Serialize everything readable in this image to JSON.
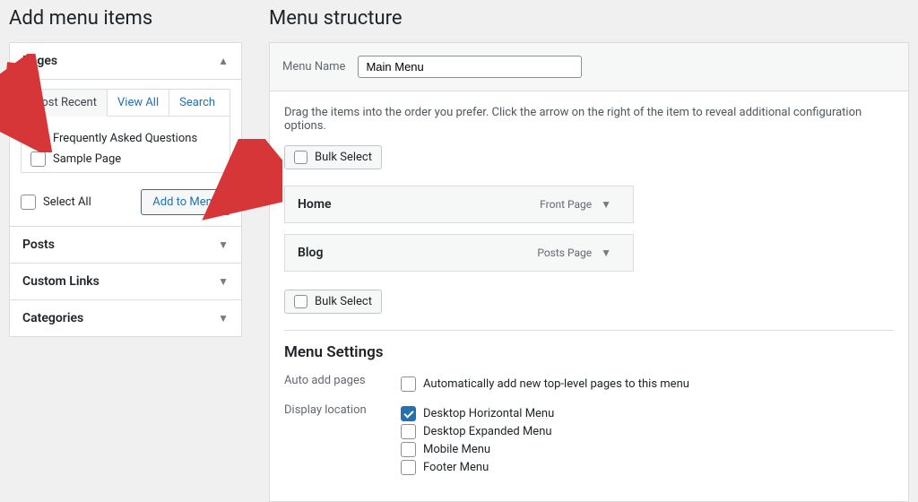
{
  "left_heading": "Add menu items",
  "right_heading": "Menu structure",
  "pages_section": {
    "title": "Pages",
    "tabs": [
      "Most Recent",
      "View All",
      "Search"
    ],
    "items": [
      {
        "label": "Frequently Asked Questions",
        "checked": true
      },
      {
        "label": "Sample Page",
        "checked": false
      }
    ],
    "select_all": "Select All",
    "add_button": "Add to Menu"
  },
  "collapsed_sections": [
    "Posts",
    "Custom Links",
    "Categories"
  ],
  "menu_name_label": "Menu Name",
  "menu_name_value": "Main Menu",
  "hint_text": "Drag the items into the order you prefer. Click the arrow on the right of the item to reveal additional configuration options.",
  "bulk_select_label": "Bulk Select",
  "menu_items": [
    {
      "title": "Home",
      "meta": "Front Page"
    },
    {
      "title": "Blog",
      "meta": "Posts Page"
    }
  ],
  "settings_heading": "Menu Settings",
  "settings": {
    "auto_add_label": "Auto add pages",
    "auto_add_option": "Automatically add new top-level pages to this menu",
    "display_label": "Display location",
    "locations": [
      {
        "label": "Desktop Horizontal Menu",
        "checked": true
      },
      {
        "label": "Desktop Expanded Menu",
        "checked": false
      },
      {
        "label": "Mobile Menu",
        "checked": false
      },
      {
        "label": "Footer Menu",
        "checked": false
      }
    ]
  }
}
